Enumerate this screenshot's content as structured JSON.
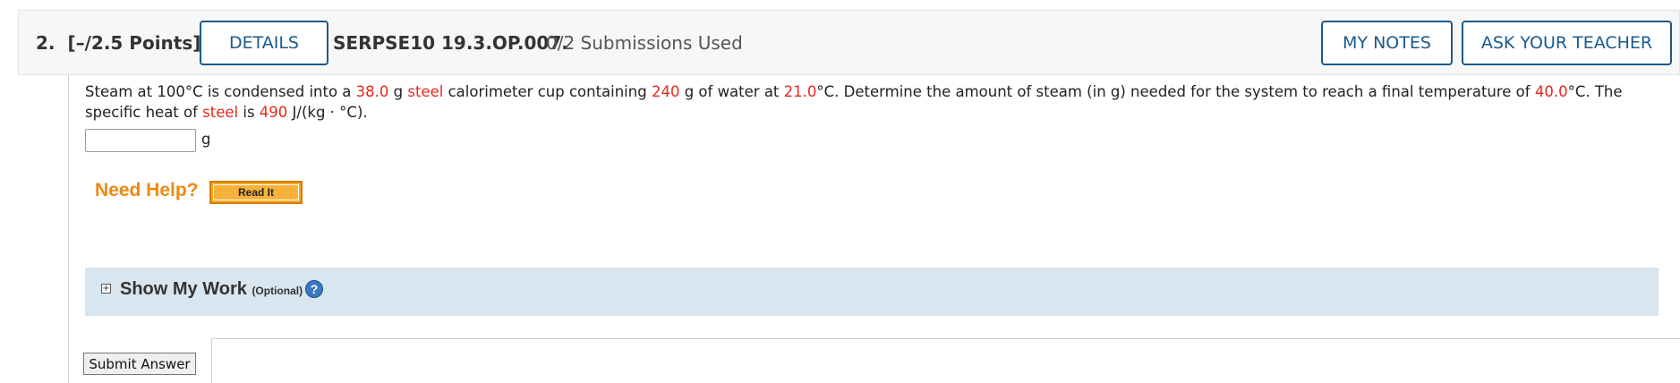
{
  "header": {
    "question_number": "2.",
    "points": "[–/2.5 Points]",
    "details_label": "DETAILS",
    "problem_code": "SERPSE10 19.3.OP.007.",
    "submissions": "0/2 Submissions Used",
    "my_notes_label": "MY NOTES",
    "ask_teacher_label": "ASK YOUR TEACHER"
  },
  "question": {
    "t1": "Steam at 100°C is condensed into a ",
    "mass_cup": "38.0",
    "t2": " g ",
    "material1": "steel",
    "t3": " calorimeter cup containing ",
    "water_mass": "240",
    "t4": " g of water at ",
    "initial_temp": "21.0",
    "t5": "°C. Determine the amount of steam (in g) needed for the system to reach a final temperature of ",
    "final_temp": "40.0",
    "t6": "°C. The specific heat of ",
    "material2": "steel",
    "t7": " is ",
    "specific_heat": "490",
    "t8": " J/(kg · °C)."
  },
  "answer": {
    "value": "",
    "unit": "g"
  },
  "help": {
    "need_help_label": "Need Help?",
    "read_it_label": "Read It"
  },
  "show_my_work": {
    "toggle_symbol": "+",
    "title": "Show My Work",
    "optional": "(Optional)",
    "help_symbol": "?"
  },
  "submit_label": "Submit Answer",
  "colors": {
    "accent": "#1a5a8d",
    "highlight": "#e8281c",
    "need_help": "#ee8a12",
    "work_panel": "#d9e5ef"
  }
}
